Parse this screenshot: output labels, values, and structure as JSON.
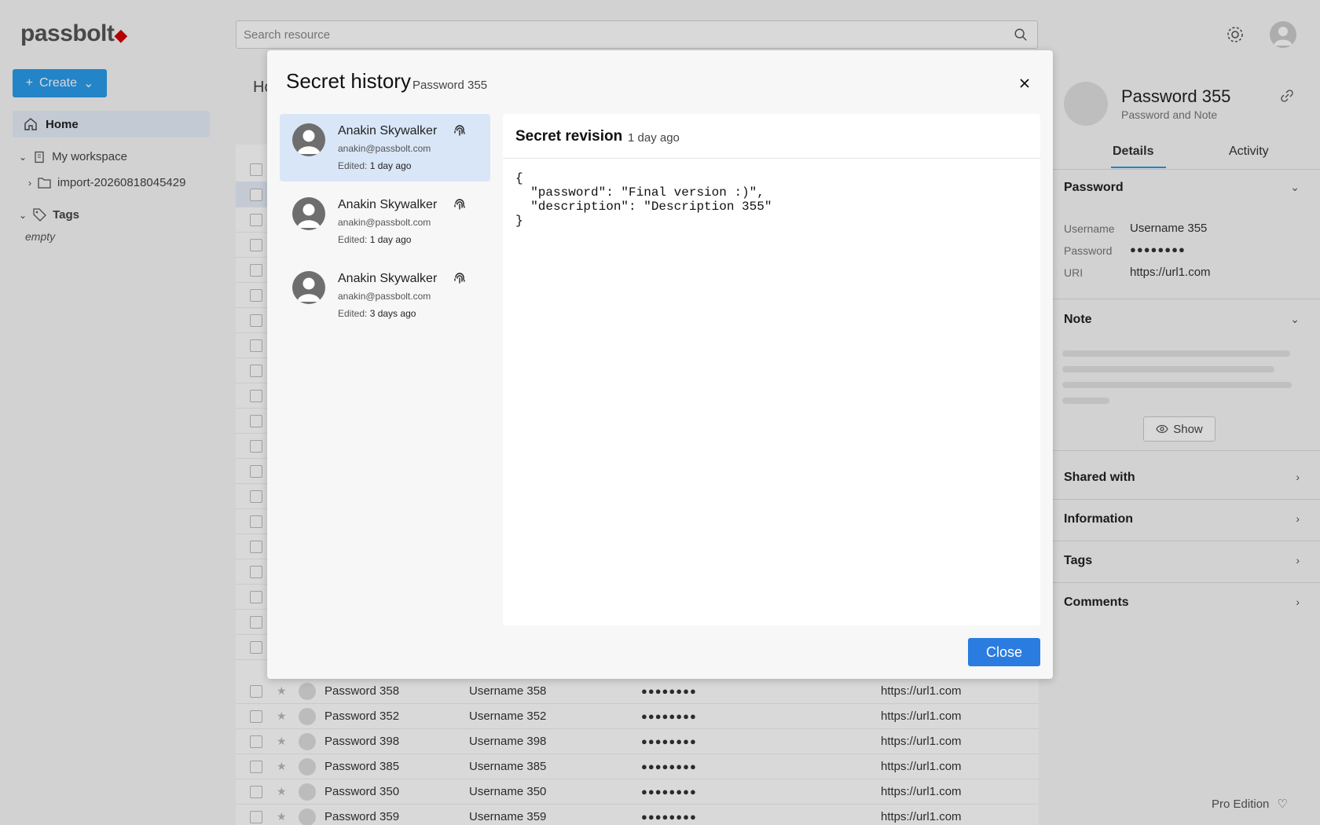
{
  "app": {
    "logo_text": "passbolt",
    "search": {
      "placeholder": "Search resource"
    },
    "create_label": "Create",
    "nav": {
      "home": "Home",
      "workspace": "My workspace",
      "folder": "import-20260818045429",
      "tags": "Tags",
      "tags_empty": "empty"
    },
    "breadcrumb": "Ho",
    "rows": [
      {
        "name": "Password 358",
        "username": "Username 358",
        "password": "●●●●●●●●",
        "uri": "https://url1.com"
      },
      {
        "name": "Password 352",
        "username": "Username 352",
        "password": "●●●●●●●●",
        "uri": "https://url1.com"
      },
      {
        "name": "Password 398",
        "username": "Username 398",
        "password": "●●●●●●●●",
        "uri": "https://url1.com"
      },
      {
        "name": "Password 385",
        "username": "Username 385",
        "password": "●●●●●●●●",
        "uri": "https://url1.com"
      },
      {
        "name": "Password 350",
        "username": "Username 350",
        "password": "●●●●●●●●",
        "uri": "https://url1.com"
      },
      {
        "name": "Password 359",
        "username": "Username 359",
        "password": "●●●●●●●●",
        "uri": "https://url1.com"
      }
    ],
    "sidebar": {
      "title": "Password 355",
      "subtitle": "Password and Note",
      "tab_details": "Details",
      "tab_activity": "Activity",
      "section_password": "Password",
      "username_label": "Username",
      "username_value": "Username 355",
      "password_label": "Password",
      "password_value": "●●●●●●●●",
      "uri_label": "URI",
      "uri_value": "https://url1.com",
      "section_note": "Note",
      "show_label": "Show",
      "section_shared": "Shared with",
      "section_information": "Information",
      "section_tags": "Tags",
      "section_comments": "Comments"
    },
    "edition": "Pro Edition"
  },
  "dialog": {
    "title": "Secret history",
    "subtitle": "Password 355",
    "close_button": "Close",
    "revisions": [
      {
        "name": "Anakin Skywalker",
        "email": "anakin@passbolt.com",
        "edited_label": "Edited:",
        "edited_when": "1 day ago",
        "active": true
      },
      {
        "name": "Anakin Skywalker",
        "email": "anakin@passbolt.com",
        "edited_label": "Edited:",
        "edited_when": "1 day ago",
        "active": false
      },
      {
        "name": "Anakin Skywalker",
        "email": "anakin@passbolt.com",
        "edited_label": "Edited:",
        "edited_when": "3 days ago",
        "active": false
      }
    ],
    "panel": {
      "heading": "Secret revision",
      "time": "1 day ago",
      "content": "{\n  \"password\": \"Final version :)\",\n  \"description\": \"Description 355\"\n}"
    }
  },
  "colors": {
    "primary": "#2a7ce0",
    "selected_row": "#d9e6f7",
    "brand_accent": "#d40101"
  }
}
